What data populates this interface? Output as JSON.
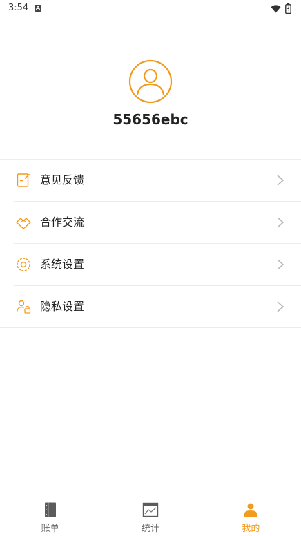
{
  "status_bar": {
    "time": "3:54",
    "notification_glyph": "A"
  },
  "profile": {
    "username": "55656ebc",
    "avatar_icon": "user-avatar-icon"
  },
  "menu": {
    "items": [
      {
        "label": "意见反馈",
        "icon": "feedback-icon"
      },
      {
        "label": "合作交流",
        "icon": "handshake-icon"
      },
      {
        "label": "系统设置",
        "icon": "gear-icon"
      },
      {
        "label": "隐私设置",
        "icon": "privacy-user-lock-icon"
      }
    ]
  },
  "bottom_nav": {
    "tabs": [
      {
        "label": "账单",
        "icon": "notebook-icon",
        "active": false
      },
      {
        "label": "统计",
        "icon": "chart-icon",
        "active": false
      },
      {
        "label": "我的",
        "icon": "person-icon",
        "active": true
      }
    ]
  },
  "colors": {
    "accent": "#f29c1f",
    "divider": "#ececec",
    "chevron": "#b8b8b8",
    "text": "#222222"
  }
}
